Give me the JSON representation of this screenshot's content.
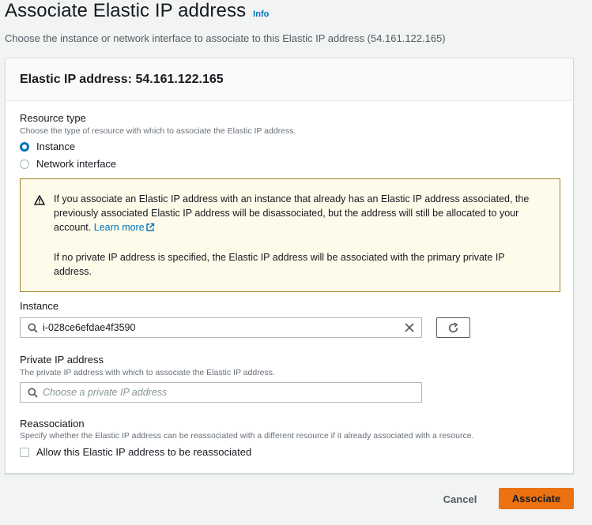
{
  "page": {
    "title": "Associate Elastic IP address",
    "info_label": "Info",
    "description": "Choose the instance or network interface to associate to this Elastic IP address (54.161.122.165)"
  },
  "panel": {
    "title": "Elastic IP address: 54.161.122.165"
  },
  "resource_type": {
    "label": "Resource type",
    "description": "Choose the type of resource with which to associate the Elastic IP address.",
    "options": [
      {
        "label": "Instance",
        "selected": true
      },
      {
        "label": "Network interface",
        "selected": false
      }
    ]
  },
  "warning": {
    "text1": "If you associate an Elastic IP address with an instance that already has an Elastic IP address associated, the previously associated Elastic IP address will be disassociated, but the address will still be allocated to your account.",
    "link": "Learn more",
    "text2": "If no private IP address is specified, the Elastic IP address will be associated with the primary private IP address."
  },
  "instance": {
    "label": "Instance",
    "value": "i-028ce6efdae4f3590"
  },
  "private_ip": {
    "label": "Private IP address",
    "description": "The private IP address with which to associate the Elastic IP address.",
    "placeholder": "Choose a private IP address"
  },
  "reassociation": {
    "label": "Reassociation",
    "description": "Specify whether the Elastic IP address can be reassociated with a different resource if it already associated with a resource.",
    "checkbox_label": "Allow this Elastic IP address to be reassociated",
    "checked": false
  },
  "footer": {
    "cancel_label": "Cancel",
    "associate_label": "Associate"
  },
  "colors": {
    "accent": "#0073bb",
    "primary_button": "#ec7211",
    "warning_bg": "#fffbea",
    "warning_border": "#a0822a"
  },
  "icons": {
    "warning": "warning-icon",
    "search": "search-icon",
    "clear": "close-icon",
    "refresh": "refresh-icon",
    "external": "external-link-icon"
  }
}
